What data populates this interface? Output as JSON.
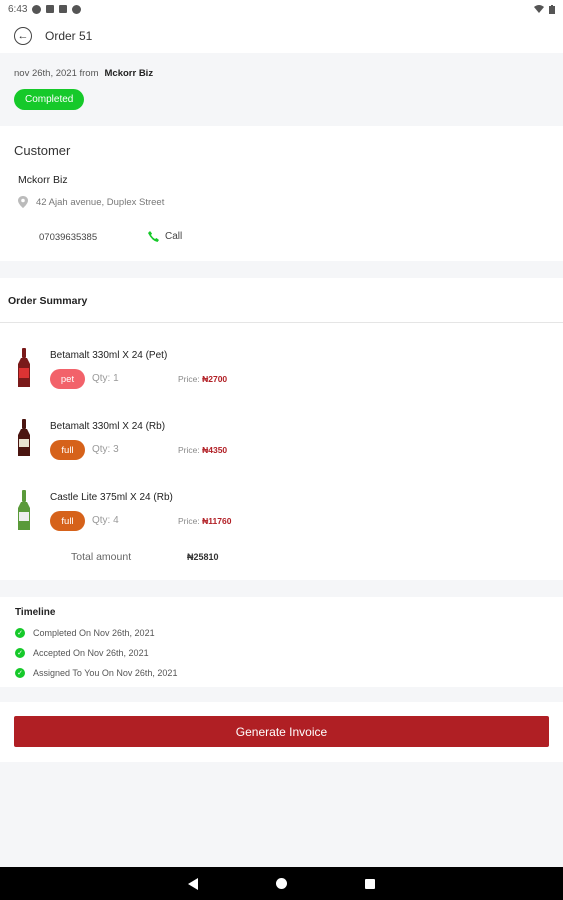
{
  "status_bar": {
    "time": "6:43"
  },
  "app_bar": {
    "title": "Order 51"
  },
  "order": {
    "date_text": "nov 26th, 2021 from",
    "from": "Mckorr Biz",
    "status": "Completed"
  },
  "customer": {
    "section_title": "Customer",
    "name": "Mckorr Biz",
    "address": "42 Ajah avenue, Duplex Street",
    "phone": "07039635385",
    "call_label": "Call"
  },
  "summary": {
    "section_title": "Order Summary",
    "items": [
      {
        "name": "Betamalt 330ml X 24 (Pet)",
        "tag": "pet",
        "tag_color": "#f2626a",
        "qty": "Qty: 1",
        "price_label": "Price:",
        "price": "₦2700",
        "bottle_color": "#7a1a1a"
      },
      {
        "name": "Betamalt 330ml X 24 (Rb)",
        "tag": "full",
        "tag_color": "#d6621a",
        "qty": "Qty: 3",
        "price_label": "Price:",
        "price": "₦4350",
        "bottle_color": "#4a1510"
      },
      {
        "name": "Castle Lite 375ml X 24 (Rb)",
        "tag": "full",
        "tag_color": "#d6621a",
        "qty": "Qty: 4",
        "price_label": "Price:",
        "price": "₦11760",
        "bottle_color": "#5a9a3a"
      }
    ],
    "total_label": "Total amount",
    "total_value": "₦25810"
  },
  "timeline": {
    "title": "Timeline",
    "events": [
      "Completed On Nov 26th, 2021",
      "Accepted On Nov 26th, 2021",
      "Assigned To You On Nov 26th, 2021"
    ]
  },
  "invoice_button": "Generate Invoice",
  "colors": {
    "accent": "#b01f24",
    "success": "#16c92a"
  }
}
